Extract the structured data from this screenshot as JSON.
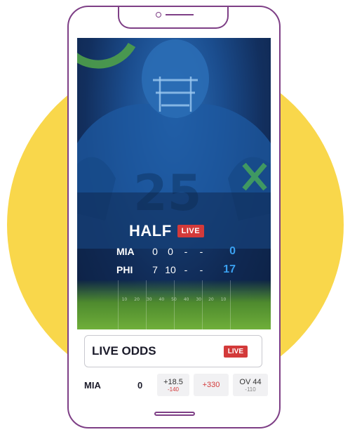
{
  "score": {
    "period_label": "HALF",
    "live_label": "LIVE",
    "teams": [
      {
        "abbr": "MIA",
        "q1": "0",
        "q2": "0",
        "q3": "-",
        "q4": "-",
        "total": "0"
      },
      {
        "abbr": "PHI",
        "q1": "7",
        "q2": "10",
        "q3": "-",
        "q4": "-",
        "total": "17"
      }
    ]
  },
  "field": {
    "yard_markers": [
      "10",
      "20",
      "30",
      "40",
      "50",
      "40",
      "30",
      "20",
      "10"
    ]
  },
  "odds": {
    "title": "LIVE ODDS",
    "live_label": "LIVE",
    "row": {
      "team": "MIA",
      "score": "0",
      "spread": "+18.5",
      "spread_odds": "-140",
      "moneyline": "+330",
      "total": "OV 44",
      "total_odds": "-110"
    }
  },
  "colors": {
    "accent_purple": "#7E3F86",
    "yellow_circle": "#F9D74B",
    "live_red": "#D33A3A",
    "score_blue": "#3AA0F0"
  }
}
